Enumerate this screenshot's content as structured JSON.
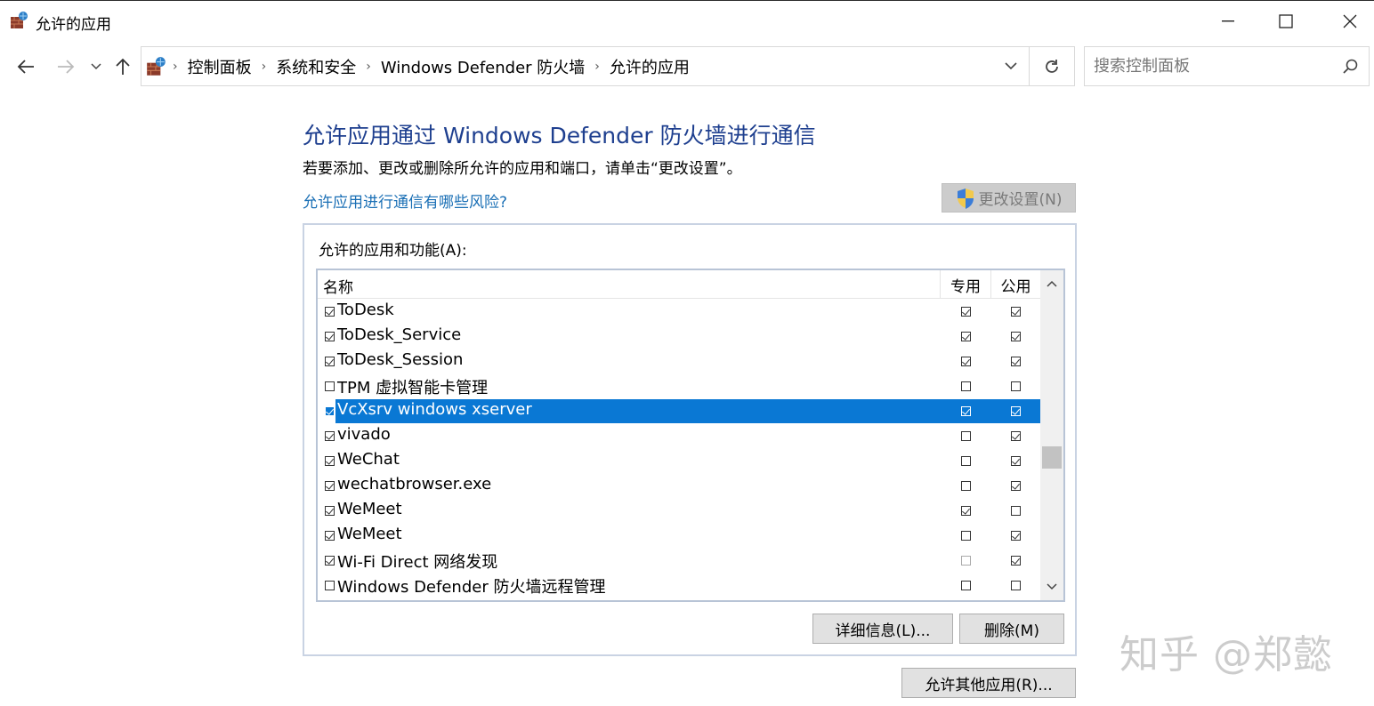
{
  "window": {
    "title": "允许的应用"
  },
  "address_bar": {
    "breadcrumbs": [
      "控制面板",
      "系统和安全",
      "Windows Defender 防火墙",
      "允许的应用"
    ],
    "separator": "›"
  },
  "search": {
    "placeholder": "搜索控制面板",
    "value": ""
  },
  "main": {
    "heading": "允许应用通过 Windows Defender 防火墙进行通信",
    "description": "若要添加、更改或删除所允许的应用和端口，请单击“更改设置”。",
    "risk_link": "允许应用进行通信有哪些风险?",
    "change_settings_button": "更改设置(N)",
    "group_label": "允许的应用和功能(A):",
    "columns": {
      "name": "名称",
      "private": "专用",
      "public": "公用"
    },
    "apps": [
      {
        "name": "ToDesk",
        "enabled": true,
        "private": true,
        "public": true,
        "selected": false
      },
      {
        "name": "ToDesk_Service",
        "enabled": true,
        "private": true,
        "public": true,
        "selected": false
      },
      {
        "name": "ToDesk_Session",
        "enabled": true,
        "private": true,
        "public": true,
        "selected": false
      },
      {
        "name": "TPM 虚拟智能卡管理",
        "enabled": false,
        "private": false,
        "public": false,
        "selected": false
      },
      {
        "name": "VcXsrv windows xserver",
        "enabled": true,
        "private": true,
        "public": true,
        "selected": true
      },
      {
        "name": "vivado",
        "enabled": true,
        "private": false,
        "public": true,
        "selected": false
      },
      {
        "name": "WeChat",
        "enabled": true,
        "private": false,
        "public": true,
        "selected": false
      },
      {
        "name": "wechatbrowser.exe",
        "enabled": true,
        "private": false,
        "public": true,
        "selected": false
      },
      {
        "name": "WeMeet",
        "enabled": true,
        "private": true,
        "public": false,
        "selected": false
      },
      {
        "name": "WeMeet",
        "enabled": true,
        "private": false,
        "public": true,
        "selected": false
      },
      {
        "name": "Wi-Fi Direct 网络发现",
        "enabled": true,
        "private": false,
        "public": true,
        "selected": false,
        "private_faint": true
      },
      {
        "name": "Windows Defender 防火墙远程管理",
        "enabled": false,
        "private": false,
        "public": false,
        "selected": false
      }
    ],
    "details_button": "详细信息(L)...",
    "remove_button": "删除(M)",
    "allow_other_button": "允许其他应用(R)..."
  },
  "watermark": "知乎 @郑懿",
  "colors": {
    "heading": "#1e3f8f",
    "link": "#1a6fb5",
    "selection": "#0a78d4"
  }
}
